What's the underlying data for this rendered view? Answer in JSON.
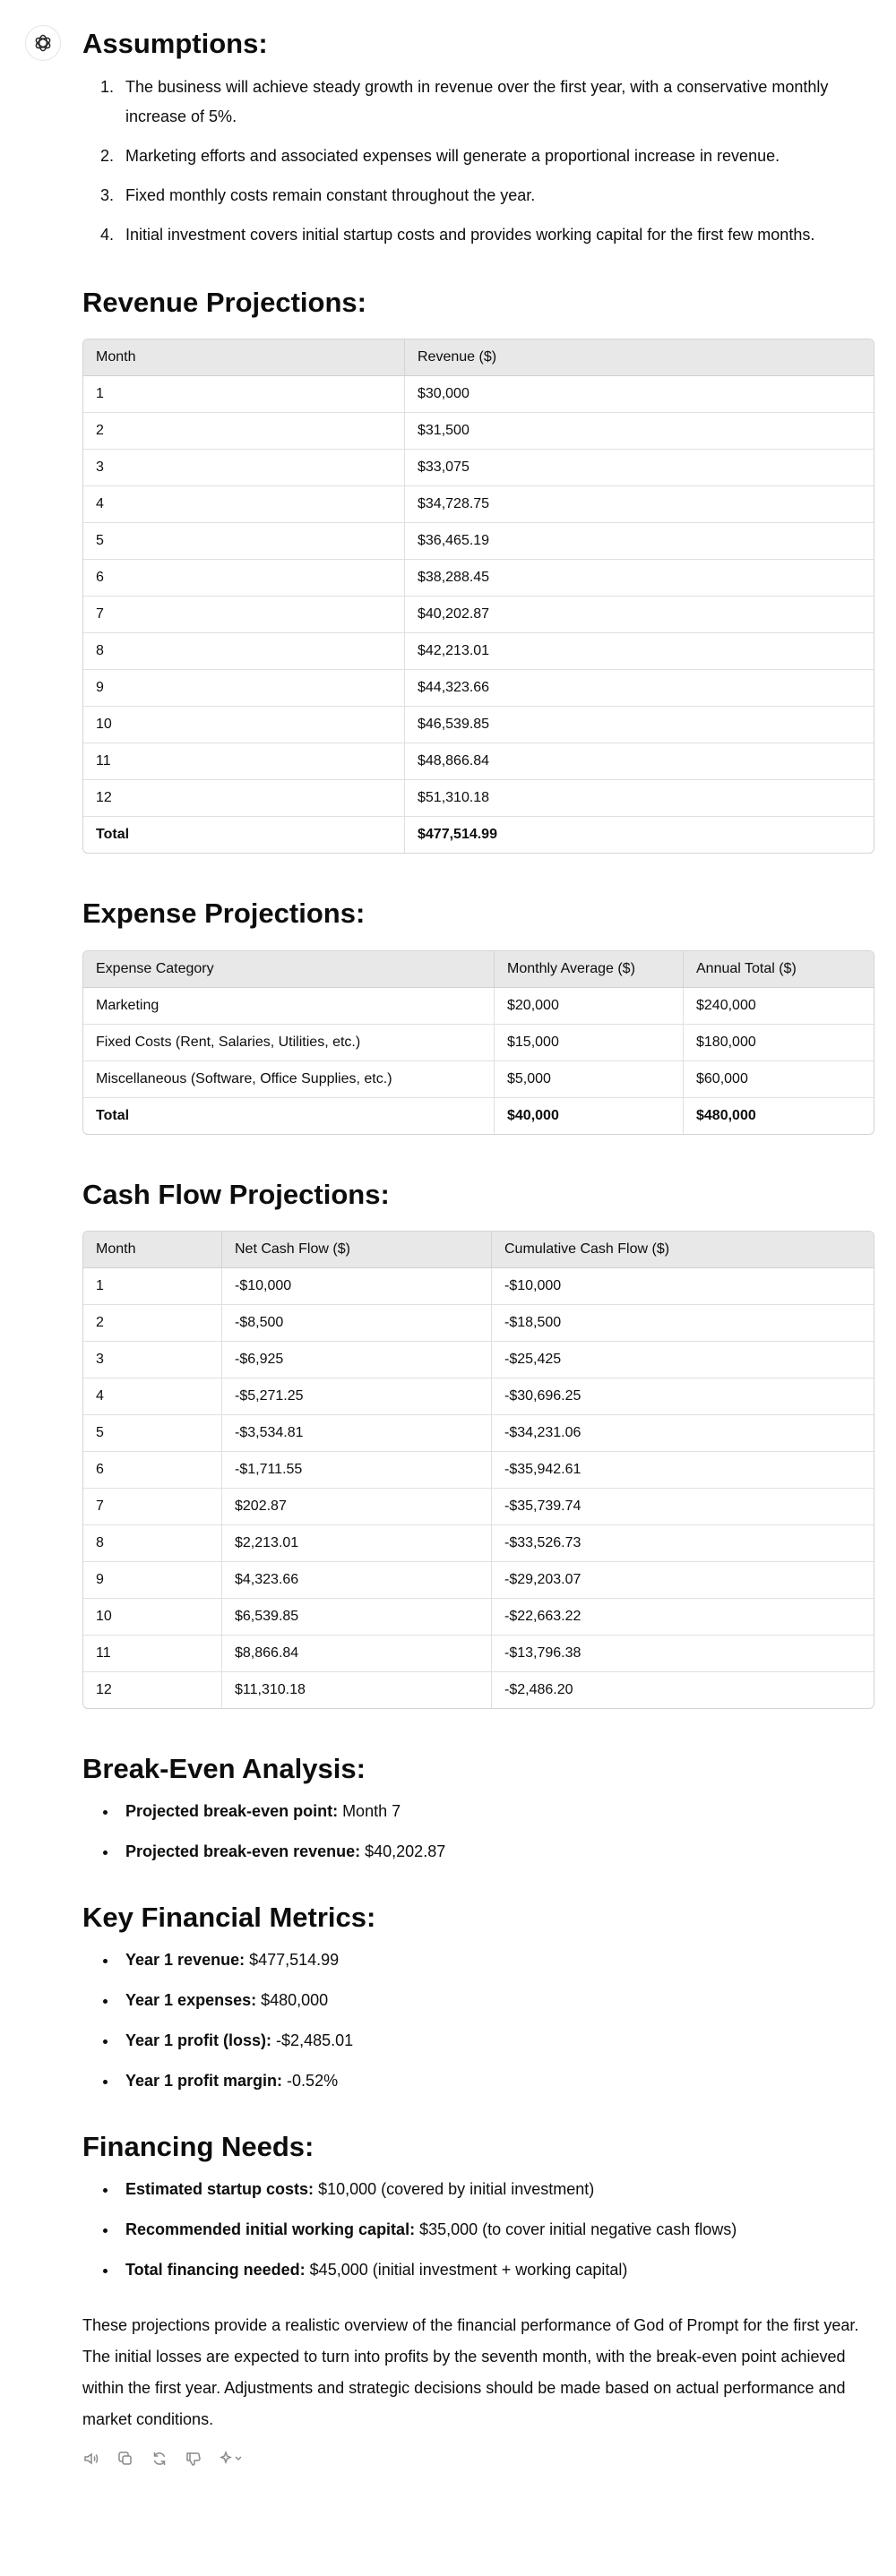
{
  "assumptions": {
    "heading": "Assumptions:",
    "items": [
      "The business will achieve steady growth in revenue over the first year, with a conservative monthly increase of 5%.",
      "Marketing efforts and associated expenses will generate a proportional increase in revenue.",
      "Fixed monthly costs remain constant throughout the year.",
      "Initial investment covers initial startup costs and provides working capital for the first few months."
    ]
  },
  "revenue": {
    "heading": "Revenue Projections:",
    "headers": [
      "Month",
      "Revenue ($)"
    ],
    "rows": [
      [
        "1",
        "$30,000"
      ],
      [
        "2",
        "$31,500"
      ],
      [
        "3",
        "$33,075"
      ],
      [
        "4",
        "$34,728.75"
      ],
      [
        "5",
        "$36,465.19"
      ],
      [
        "6",
        "$38,288.45"
      ],
      [
        "7",
        "$40,202.87"
      ],
      [
        "8",
        "$42,213.01"
      ],
      [
        "9",
        "$44,323.66"
      ],
      [
        "10",
        "$46,539.85"
      ],
      [
        "11",
        "$48,866.84"
      ],
      [
        "12",
        "$51,310.18"
      ]
    ],
    "total": [
      "Total",
      "$477,514.99"
    ]
  },
  "expenses": {
    "heading": "Expense Projections:",
    "headers": [
      "Expense Category",
      "Monthly Average ($)",
      "Annual Total ($)"
    ],
    "rows": [
      [
        "Marketing",
        "$20,000",
        "$240,000"
      ],
      [
        "Fixed Costs (Rent, Salaries, Utilities, etc.)",
        "$15,000",
        "$180,000"
      ],
      [
        "Miscellaneous (Software, Office Supplies, etc.)",
        "$5,000",
        "$60,000"
      ]
    ],
    "total": [
      "Total",
      "$40,000",
      "$480,000"
    ]
  },
  "cashflow": {
    "heading": "Cash Flow Projections:",
    "headers": [
      "Month",
      "Net Cash Flow ($)",
      "Cumulative Cash Flow ($)"
    ],
    "rows": [
      [
        "1",
        "-$10,000",
        "-$10,000"
      ],
      [
        "2",
        "-$8,500",
        "-$18,500"
      ],
      [
        "3",
        "-$6,925",
        "-$25,425"
      ],
      [
        "4",
        "-$5,271.25",
        "-$30,696.25"
      ],
      [
        "5",
        "-$3,534.81",
        "-$34,231.06"
      ],
      [
        "6",
        "-$1,711.55",
        "-$35,942.61"
      ],
      [
        "7",
        "$202.87",
        "-$35,739.74"
      ],
      [
        "8",
        "$2,213.01",
        "-$33,526.73"
      ],
      [
        "9",
        "$4,323.66",
        "-$29,203.07"
      ],
      [
        "10",
        "$6,539.85",
        "-$22,663.22"
      ],
      [
        "11",
        "$8,866.84",
        "-$13,796.38"
      ],
      [
        "12",
        "$11,310.18",
        "-$2,486.20"
      ]
    ]
  },
  "breakeven": {
    "heading": "Break-Even Analysis:",
    "items": [
      {
        "label": "Projected break-even point:",
        "value": " Month 7"
      },
      {
        "label": "Projected break-even revenue:",
        "value": " $40,202.87"
      }
    ]
  },
  "metrics": {
    "heading": "Key Financial Metrics:",
    "items": [
      {
        "label": "Year 1 revenue:",
        "value": " $477,514.99"
      },
      {
        "label": "Year 1 expenses:",
        "value": " $480,000"
      },
      {
        "label": "Year 1 profit (loss):",
        "value": " -$2,485.01"
      },
      {
        "label": "Year 1 profit margin:",
        "value": " -0.52%"
      }
    ]
  },
  "financing": {
    "heading": "Financing Needs:",
    "items": [
      {
        "label": "Estimated startup costs:",
        "value": " $10,000 (covered by initial investment)"
      },
      {
        "label": "Recommended initial working capital:",
        "value": " $35,000 (to cover initial negative cash flows)"
      },
      {
        "label": "Total financing needed:",
        "value": " $45,000 (initial investment + working capital)"
      }
    ]
  },
  "summary": "These projections provide a realistic overview of the financial performance of God of Prompt for the first year. The initial losses are expected to turn into profits by the seventh month, with the break-even point achieved within the first year. Adjustments and strategic decisions should be made based on actual performance and market conditions.",
  "icons": {
    "avatar": "assistant-logo-icon",
    "actions": [
      "read-aloud-icon",
      "copy-icon",
      "regenerate-icon",
      "thumbs-down-icon",
      "model-switch-icon"
    ]
  }
}
